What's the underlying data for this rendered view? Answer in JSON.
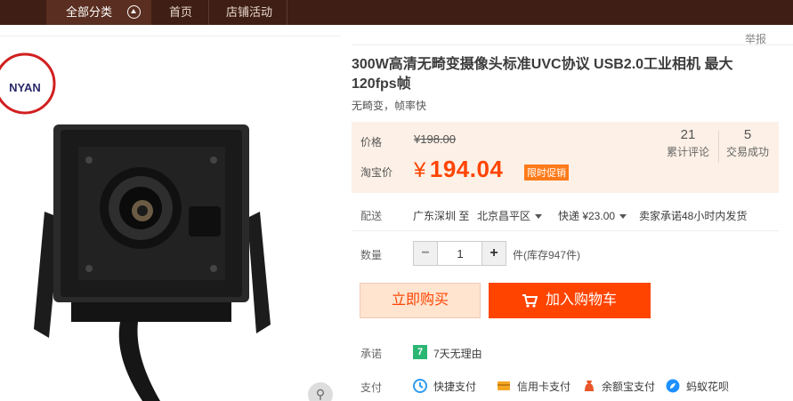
{
  "nav": {
    "category_label": "全部分类",
    "links": [
      "首页",
      "店铺活动"
    ]
  },
  "brand": {
    "logo_text": "NYAN"
  },
  "product": {
    "title": "300W高清无畸变摄像头标准UVC协议 USB2.0工业相机 最大120fps帧",
    "subtitle": "无畸变，帧率快",
    "report_label": "举报"
  },
  "price": {
    "price_label": "价格",
    "original": "¥198.00",
    "taobao_label": "淘宝价",
    "currency": "¥",
    "current": "194.04",
    "promo_badge": "限时促销",
    "accent_color": "#ff4400"
  },
  "stats": [
    {
      "value": "21",
      "label": "累计评论"
    },
    {
      "value": "5",
      "label": "交易成功"
    }
  ],
  "shipping": {
    "label": "配送",
    "from": "广东深圳 至",
    "to": "北京昌平区",
    "method": "快递 ¥23.00",
    "promise": "卖家承诺48小时内发货"
  },
  "quantity": {
    "label": "数量",
    "value": "1",
    "minus": "−",
    "plus": "+",
    "stock": "件(库存947件)"
  },
  "actions": {
    "buy_now": "立即购买",
    "add_to_cart": "加入购物车"
  },
  "promise": {
    "label": "承诺",
    "icon_text": "7",
    "text": "7天无理由"
  },
  "payment": {
    "label": "支付",
    "methods": [
      "快捷支付",
      "信用卡支付",
      "余额宝支付",
      "蚂蚁花呗"
    ]
  },
  "icons": {
    "category": "chevron-up-circle-icon",
    "zoom": "magnifier-icon",
    "cart": "cart-icon"
  }
}
